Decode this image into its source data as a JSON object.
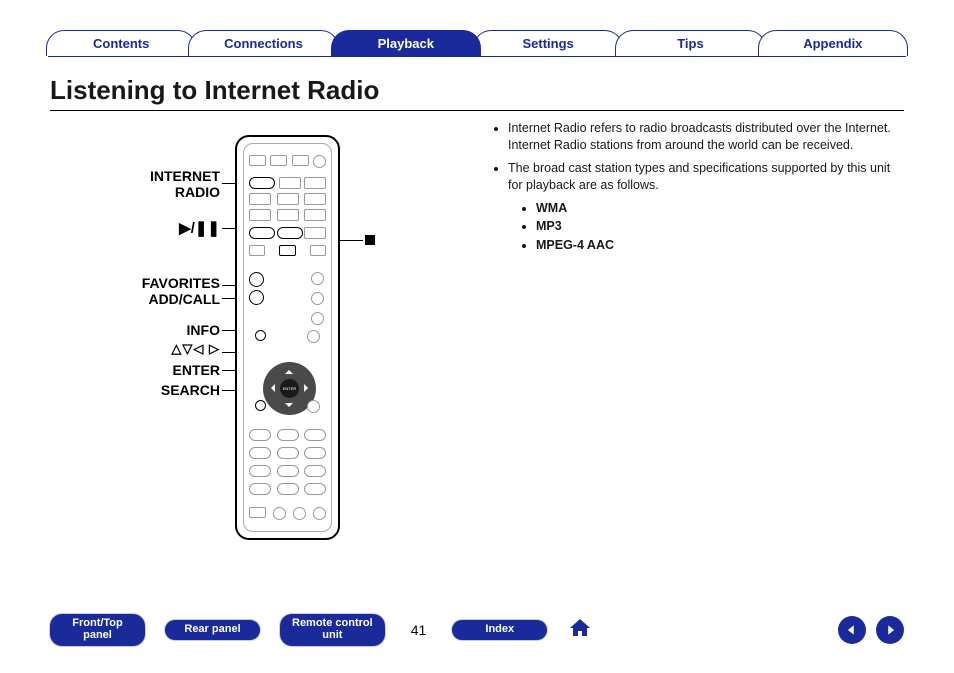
{
  "tabs": [
    "Contents",
    "Connections",
    "Playback",
    "Settings",
    "Tips",
    "Appendix"
  ],
  "active_tab": "Playback",
  "title": "Listening to Internet Radio",
  "callouts": {
    "internet_radio_l1": "INTERNET",
    "internet_radio_l2": "RADIO",
    "play_pause": "▶/❙❙",
    "favorites": "FAVORITES",
    "add_call": "ADD/CALL",
    "info": "INFO",
    "dirs": "△▽◁ ▷",
    "enter": "ENTER",
    "search": "SEARCH"
  },
  "info": {
    "bullets": [
      "Internet Radio refers to radio broadcasts distributed over the Internet. Internet Radio stations from around the world can be received.",
      "The broad cast station types and specifications supported by this unit for playback are as follows."
    ],
    "formats": [
      "WMA",
      "MP3",
      "MPEG-4 AAC"
    ]
  },
  "bottom": {
    "front_top_l1": "Front/Top",
    "front_top_l2": "panel",
    "rear": "Rear panel",
    "remote_l1": "Remote control",
    "remote_l2": "unit",
    "index": "Index",
    "page": "41"
  }
}
